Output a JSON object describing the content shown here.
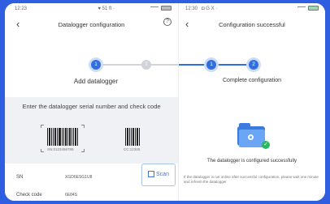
{
  "left": {
    "status_time": "12:23",
    "status_extra": "♥ 51 ft ·",
    "header_title": "Datalogger configuration",
    "step1": "1",
    "step2": "2",
    "step_label": "Add datalogger",
    "instruction": "Enter the datalogger serial number and check code",
    "barcode1_caption": "SN:0123456789",
    "barcode2_caption": "CC:12345",
    "sn_label": "SN",
    "sn_value": "XGD6ESG1U8",
    "check_label": "Check code",
    "check_value": "6E84S",
    "scan_label": "Scan"
  },
  "right": {
    "status_time": "12:30",
    "status_extra": "◘ G X ·",
    "header_title": "Configuration successful",
    "step1": "1",
    "step2": "2",
    "step_label": "Complete configuration",
    "success_text": "The datalogger is configured successfully",
    "note_text": "If the datalogger is not online after successful configuration, please wait one minute and refresh the datalogger"
  },
  "colors": {
    "accent": "#2f6fe0",
    "inactive": "#d0d3d9",
    "success": "#28b85f"
  }
}
